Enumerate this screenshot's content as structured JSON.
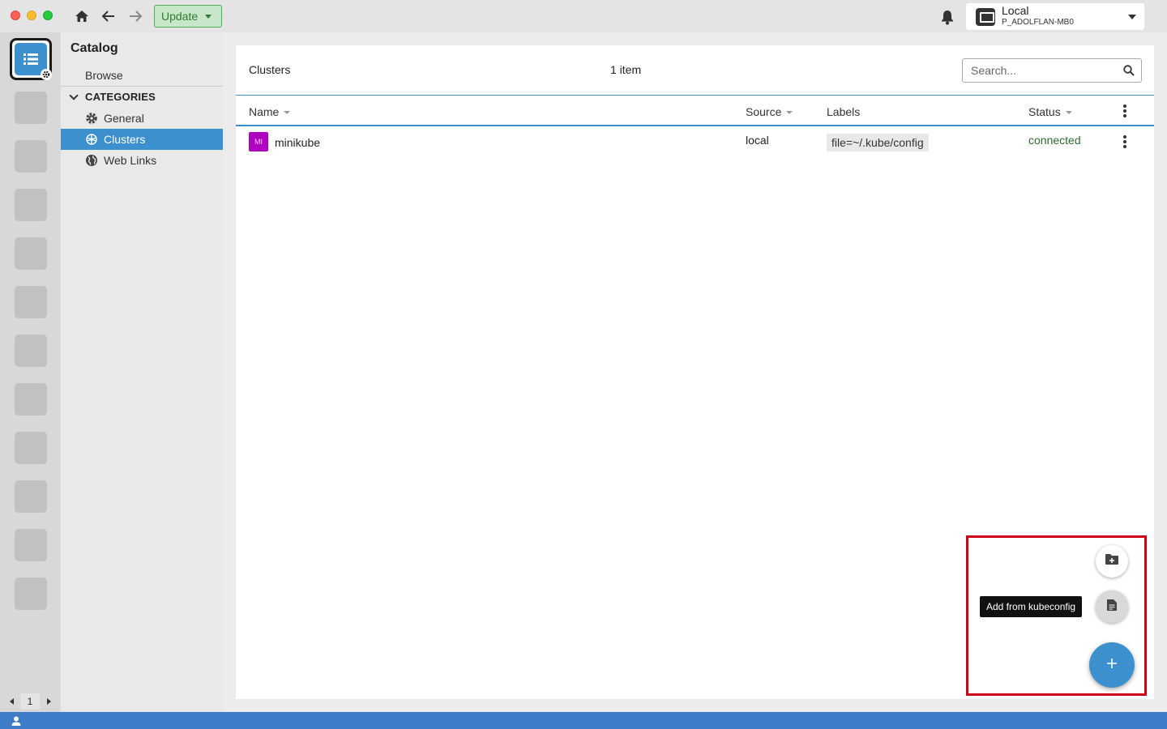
{
  "window": {
    "update_label": "Update",
    "hotbar_selector": {
      "title": "Local",
      "subtitle": "P_ADOLFLAN-MB0"
    }
  },
  "hotbar": {
    "page": "1"
  },
  "sidebar": {
    "title": "Catalog",
    "browse": "Browse",
    "categories_label": "CATEGORIES",
    "items": [
      {
        "label": "General",
        "icon": "gear-icon"
      },
      {
        "label": "Clusters",
        "icon": "kubernetes-icon",
        "active": true
      },
      {
        "label": "Web Links",
        "icon": "globe-icon"
      }
    ]
  },
  "main": {
    "title": "Clusters",
    "count": "1 item",
    "search_placeholder": "Search...",
    "columns": [
      "Name",
      "Source",
      "Labels",
      "Status"
    ],
    "rows": [
      {
        "avatar": "MI",
        "name": "minikube",
        "source": "local",
        "labels": "file=~/.kube/config",
        "status": "connected"
      }
    ]
  },
  "fab": {
    "tooltip": "Add from kubeconfig"
  },
  "colors": {
    "accent": "#3d90ce",
    "highlight": "#d0021b",
    "status_connected": "#2e6b2e",
    "avatar": "#b000c0"
  }
}
